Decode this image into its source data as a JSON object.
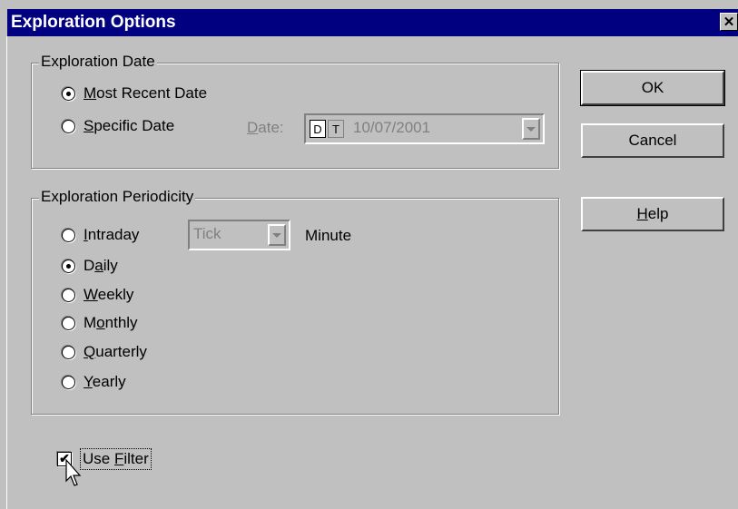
{
  "window": {
    "title": "Exploration Options",
    "close_glyph": "✕"
  },
  "date_group": {
    "legend": "Exploration Date",
    "most_recent": {
      "prefix": "",
      "accel": "M",
      "rest": "ost Recent Date",
      "checked": true
    },
    "specific": {
      "prefix": "",
      "accel": "S",
      "rest": "pecific Date",
      "checked": false
    },
    "date_label": {
      "accel": "D",
      "rest": "ate:"
    },
    "toggle_d": "D",
    "toggle_t": "T",
    "date_value": "10/07/2001"
  },
  "periodicity_group": {
    "legend": "Exploration Periodicity",
    "tick_value": "Tick",
    "minute_label": "Minute",
    "options": [
      {
        "prefix": "",
        "accel": "I",
        "rest": "ntraday",
        "checked": false
      },
      {
        "prefix": "D",
        "accel": "a",
        "rest": "ily",
        "checked": true
      },
      {
        "prefix": "",
        "accel": "W",
        "rest": "eekly",
        "checked": false
      },
      {
        "prefix": "M",
        "accel": "o",
        "rest": "nthly",
        "checked": false
      },
      {
        "prefix": "",
        "accel": "Q",
        "rest": "uarterly",
        "checked": false
      },
      {
        "prefix": "",
        "accel": "Y",
        "rest": "early",
        "checked": false
      }
    ]
  },
  "buttons": {
    "ok": "OK",
    "cancel": "Cancel",
    "help_accel": "H",
    "help_rest": "elp"
  },
  "filter": {
    "prefix": "Use ",
    "accel": "F",
    "rest": "ilter",
    "checked": true,
    "check_glyph": "✔"
  }
}
